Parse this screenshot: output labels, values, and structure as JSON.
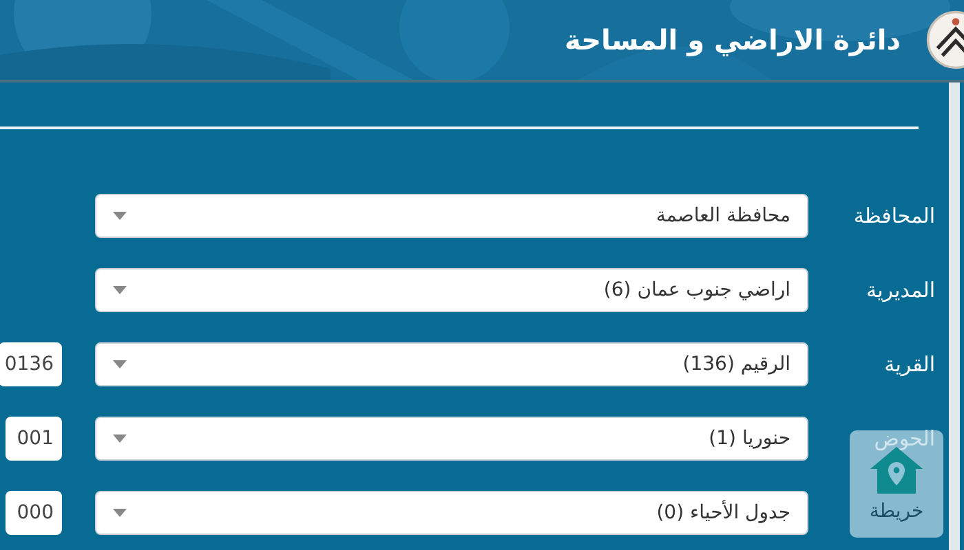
{
  "header": {
    "title": "دائرة الاراضي و المساحة"
  },
  "fields": [
    {
      "label": "المحافظة",
      "value": "محافظة العاصمة"
    },
    {
      "label": "المديرية",
      "value": "اراضي جنوب عمان (6)"
    },
    {
      "label": "القرية",
      "value": "الرقيم (136)",
      "code": "0136"
    },
    {
      "label": "الحوض",
      "value": "حنوريا (1)",
      "code": "001"
    },
    {
      "value": "جدول الأحياء (0)",
      "code": "000"
    }
  ],
  "map_button": {
    "label": "خريطة"
  }
}
